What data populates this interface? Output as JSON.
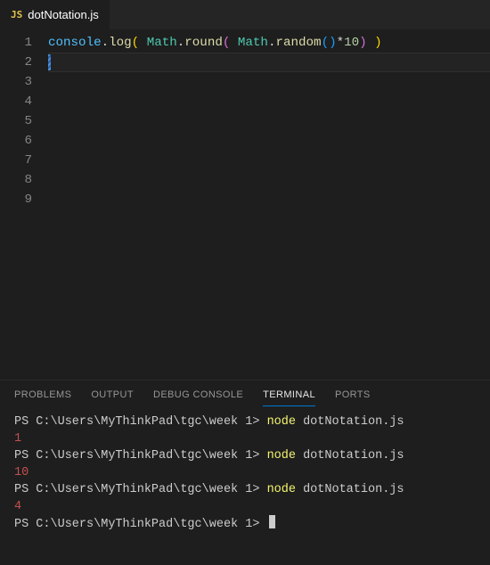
{
  "tab": {
    "icon_label": "JS",
    "filename": "dotNotation.js"
  },
  "editor": {
    "line_count": 9,
    "active_line": 2,
    "code_line1": {
      "obj": "console",
      "dot1": ".",
      "fn1": "log",
      "open1": "(",
      "space1": " ",
      "class1": "Math",
      "dot2": ".",
      "fn2": "round",
      "open2": "(",
      "space2": " ",
      "class2": "Math",
      "dot3": ".",
      "fn3": "random",
      "open3": "(",
      "close3": ")",
      "op": "*",
      "num": "10",
      "close2": ")",
      "space3": " ",
      "close1": ")"
    }
  },
  "panel": {
    "tabs": {
      "problems": "PROBLEMS",
      "output": "OUTPUT",
      "debug": "DEBUG CONSOLE",
      "terminal": "TERMINAL",
      "ports": "PORTS"
    },
    "active_tab": "terminal"
  },
  "terminal": {
    "prompt": "PS C:\\Users\\MyThinkPad\\tgc\\week 1>",
    "command": "node",
    "arg": "dotNotation.js",
    "runs": [
      {
        "output": "1"
      },
      {
        "output": "10"
      },
      {
        "output": "4"
      }
    ]
  }
}
